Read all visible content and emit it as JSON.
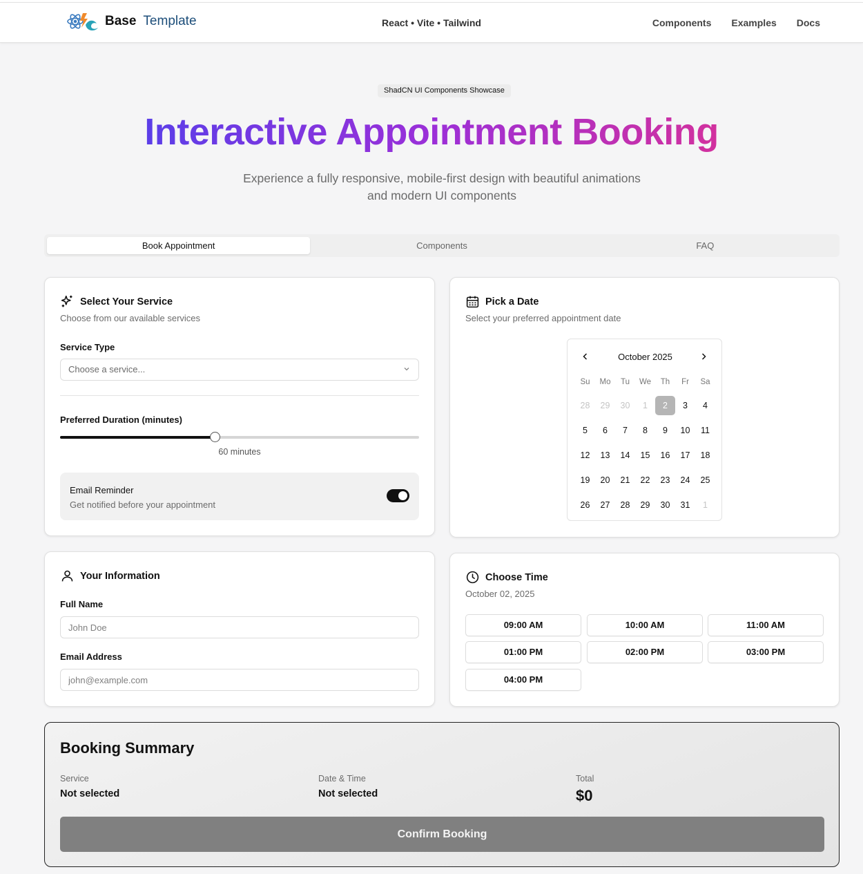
{
  "header": {
    "brand_bold": "Base",
    "brand_rest": "Template",
    "stack": "React • Vite • Tailwind",
    "nav": [
      "Components",
      "Examples",
      "Docs"
    ]
  },
  "hero": {
    "badge": "ShadCN UI Components Showcase",
    "title": "Interactive Appointment Booking",
    "subtitle_line1": "Experience a fully responsive, mobile-first design with beautiful animations",
    "subtitle_line2": "and modern UI components"
  },
  "tabs": [
    {
      "label": "Book Appointment",
      "active": true
    },
    {
      "label": "Components",
      "active": false
    },
    {
      "label": "FAQ",
      "active": false
    }
  ],
  "service": {
    "title": "Select Your Service",
    "description": "Choose from our available services",
    "type_label": "Service Type",
    "select_placeholder": "Choose a service...",
    "duration_label": "Preferred Duration (minutes)",
    "duration_fraction": 0.43,
    "duration_value": "60 minutes",
    "reminder_title": "Email Reminder",
    "reminder_desc": "Get notified before your appointment",
    "reminder_on": true
  },
  "date": {
    "title": "Pick a Date",
    "description": "Select your preferred appointment date",
    "month": "October 2025",
    "weekdays": [
      "Su",
      "Mo",
      "Tu",
      "We",
      "Th",
      "Fr",
      "Sa"
    ],
    "weeks": [
      [
        {
          "d": "28",
          "m": true
        },
        {
          "d": "29",
          "m": true
        },
        {
          "d": "30",
          "m": true
        },
        {
          "d": "1",
          "m": true
        },
        {
          "d": "2",
          "s": true
        },
        {
          "d": "3"
        },
        {
          "d": "4"
        }
      ],
      [
        {
          "d": "5"
        },
        {
          "d": "6"
        },
        {
          "d": "7"
        },
        {
          "d": "8"
        },
        {
          "d": "9"
        },
        {
          "d": "10"
        },
        {
          "d": "11"
        }
      ],
      [
        {
          "d": "12"
        },
        {
          "d": "13"
        },
        {
          "d": "14"
        },
        {
          "d": "15"
        },
        {
          "d": "16"
        },
        {
          "d": "17"
        },
        {
          "d": "18"
        }
      ],
      [
        {
          "d": "19"
        },
        {
          "d": "20"
        },
        {
          "d": "21"
        },
        {
          "d": "22"
        },
        {
          "d": "23"
        },
        {
          "d": "24"
        },
        {
          "d": "25"
        }
      ],
      [
        {
          "d": "26"
        },
        {
          "d": "27"
        },
        {
          "d": "28"
        },
        {
          "d": "29"
        },
        {
          "d": "30"
        },
        {
          "d": "31"
        },
        {
          "d": "1",
          "m": true
        }
      ]
    ]
  },
  "info": {
    "title": "Your Information",
    "name_label": "Full Name",
    "name_placeholder": "John Doe",
    "email_label": "Email Address",
    "email_placeholder": "john@example.com"
  },
  "time": {
    "title": "Choose Time",
    "date": "October 02, 2025",
    "slots": [
      "09:00 AM",
      "10:00 AM",
      "11:00 AM",
      "01:00 PM",
      "02:00 PM",
      "03:00 PM",
      "04:00 PM"
    ]
  },
  "summary": {
    "title": "Booking Summary",
    "service_label": "Service",
    "service_value": "Not selected",
    "datetime_label": "Date & Time",
    "datetime_value": "Not selected",
    "total_label": "Total",
    "total_value": "$0",
    "confirm_label": "Confirm Booking"
  }
}
